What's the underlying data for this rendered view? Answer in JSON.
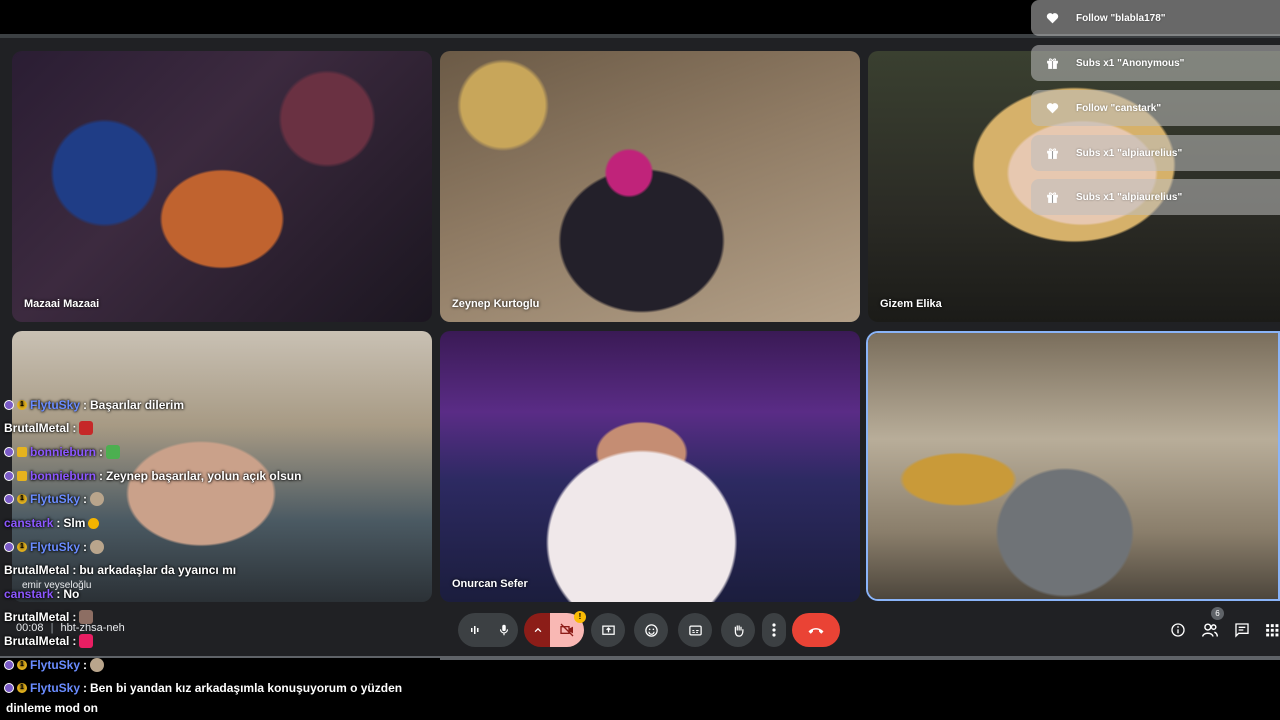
{
  "notifications": [
    {
      "icon": "heart-icon",
      "text": "Follow \"blabla178\""
    },
    {
      "icon": "gift-icon",
      "text": "Subs x1 \"Anonymous\""
    },
    {
      "icon": "heart-icon",
      "text": "Follow \"canstark\""
    },
    {
      "icon": "gift-icon",
      "text": "Subs x1 \"alpiaurelius\""
    },
    {
      "icon": "gift-icon",
      "text": "Subs x1 \"alpiaurelius\""
    }
  ],
  "participants": [
    {
      "name": "Mazaai Mazaai"
    },
    {
      "name": "Zeynep Kurtoglu"
    },
    {
      "name": "Gizem Elika"
    },
    {
      "name": ""
    },
    {
      "name": "Onurcan Sefer"
    },
    {
      "name": ""
    }
  ],
  "self_label": "emir veyseloğlu",
  "meeting": {
    "time": "00:08",
    "code": "hbt-zhsa-neh"
  },
  "people_count": "6",
  "chat": [
    {
      "user": "FlytuSky",
      "text": "Başarılar dilerim"
    },
    {
      "user": "BrutalMetal",
      "text": ""
    },
    {
      "user": "bonnieburn",
      "text": ""
    },
    {
      "user": "bonnieburn",
      "text": "Zeynep başarılar, yolun açık olsun"
    },
    {
      "user": "FlytuSky",
      "text": ""
    },
    {
      "user": "canstark",
      "text": "Slm"
    },
    {
      "user": "FlytuSky",
      "text": ""
    },
    {
      "user": "BrutalMetal",
      "text": "bu arkadaşlar da yyaıncı mı"
    },
    {
      "user": "canstark",
      "text": "No"
    },
    {
      "user": "BrutalMetal",
      "text": ""
    },
    {
      "user": "BrutalMetal",
      "text": ""
    },
    {
      "user": "FlytuSky",
      "text": ""
    },
    {
      "user": "FlytuSky",
      "text": "Ben bi yandan kız arkadaşımla konuşuyorum o yüzden"
    },
    {
      "user": "",
      "text": "dinleme mod on"
    }
  ],
  "colors": {
    "accent_blue": "#8ab4f8",
    "end_call_red": "#ea4335",
    "bar_bg": "#000000"
  }
}
